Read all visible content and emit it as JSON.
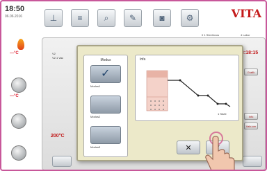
{
  "status": {
    "time": "18:50",
    "date": "06.06.2016"
  },
  "sidebar": {
    "temp_top": "—°C",
    "temp_mid": "—°C"
  },
  "brand": "VITA",
  "toolbar": {
    "sub_left": "0 1 Steelinvos",
    "sub_right": "4 Labor"
  },
  "program": {
    "num": "V2",
    "name": "V2.1 Vac",
    "time": "3:18:15",
    "start_temp": "200°C"
  },
  "right_buttons": [
    "Grafik",
    "Info",
    "Vakuum"
  ],
  "dialog": {
    "mode_title": "Modus",
    "modes": [
      "Modus1",
      "Modus2",
      "Modus3"
    ],
    "graph_title": "Infa",
    "ok_symbol": "✓",
    "cancel_symbol": "✕",
    "graph_label": "1 Stufe"
  },
  "colors": {
    "accent": "#c8579a",
    "brand": "#c41a1a",
    "dialog_bg": "#ece9c9",
    "button_blue": "#4a5e75"
  }
}
